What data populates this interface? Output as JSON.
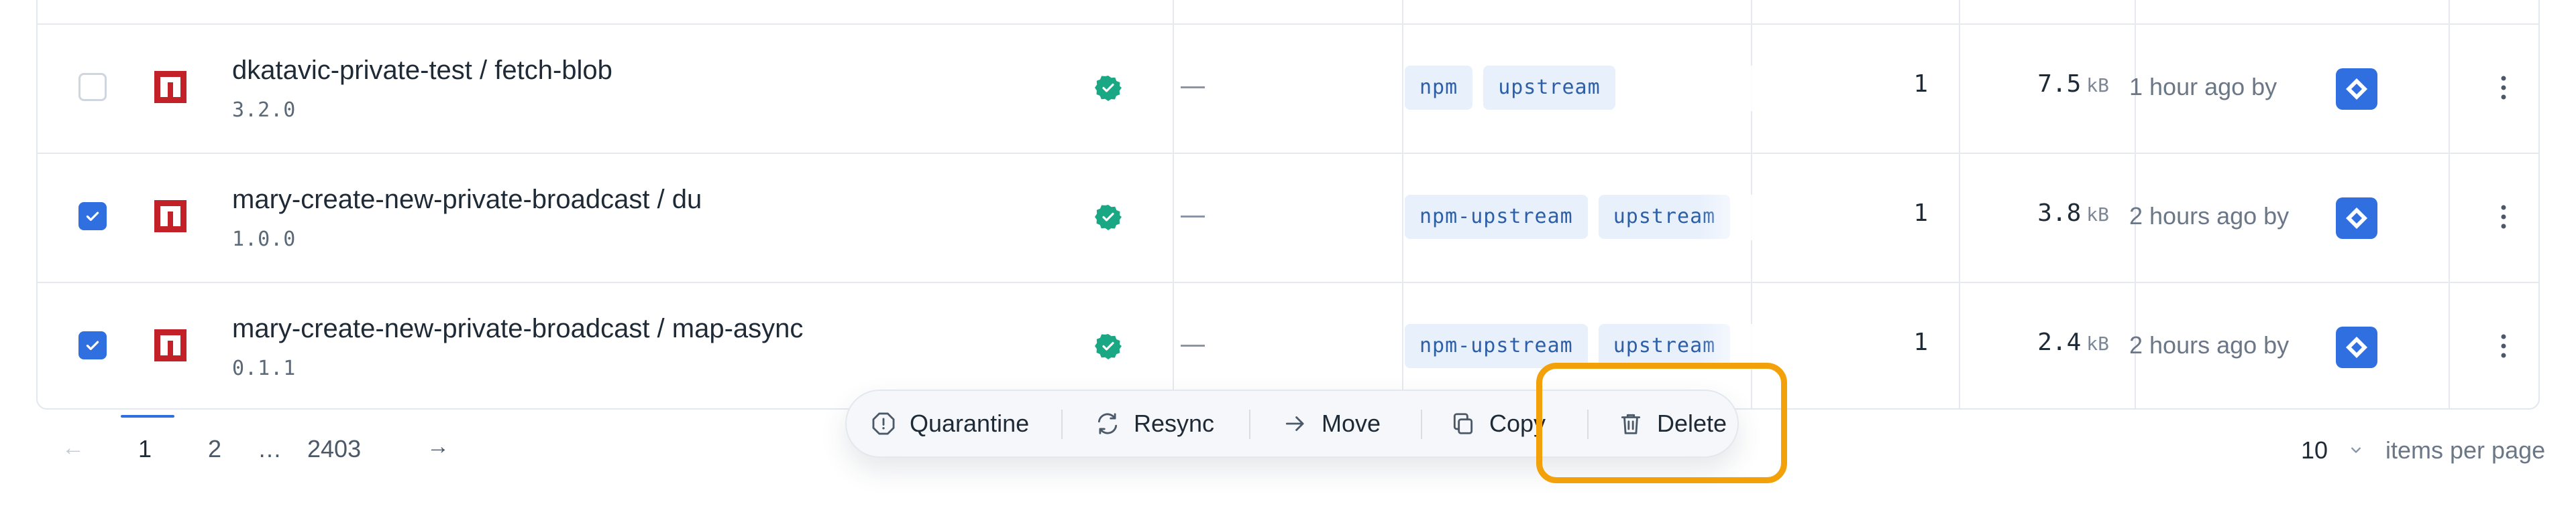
{
  "rows": [
    {
      "checked": false,
      "name": "dkatavic-private-test / fetch-blob",
      "version": "3.2.0",
      "downstreams": "—",
      "tags": [
        "npm",
        "upstream"
      ],
      "count": "1",
      "size_value": "7.5",
      "size_unit": "kB",
      "time": "1 hour ago by"
    },
    {
      "checked": true,
      "name": "mary-create-new-private-broadcast / du",
      "version": "1.0.0",
      "downstreams": "—",
      "tags": [
        "npm-upstream",
        "upstream"
      ],
      "count": "1",
      "size_value": "3.8",
      "size_unit": "kB",
      "time": "2 hours ago by"
    },
    {
      "checked": true,
      "name": "mary-create-new-private-broadcast / map-async",
      "version": "0.1.1",
      "downstreams": "—",
      "tags": [
        "npm-upstream",
        "upstream"
      ],
      "count": "1",
      "size_value": "2.4",
      "size_unit": "kB",
      "time": "2 hours ago by"
    }
  ],
  "pagination": {
    "prev_icon": "←",
    "pages": [
      "1",
      "2",
      "…",
      "2403"
    ],
    "current": "1",
    "next_icon": "→"
  },
  "items_per_page": {
    "value": "10",
    "label": "items per page"
  },
  "action_bar": {
    "quarantine": "Quarantine",
    "resync": "Resync",
    "move": "Move",
    "copy": "Copy",
    "delete": "Delete"
  },
  "colors": {
    "accent": "#2f6fe0",
    "npm_red": "#c12127",
    "sync_green": "#1aa784",
    "highlight": "#f3a10a"
  },
  "icons": {
    "package_format": "npm-icon",
    "status": "check-badge-icon",
    "avatar": "user-avatar-icon",
    "row_menu": "kebab-menu-icon"
  }
}
